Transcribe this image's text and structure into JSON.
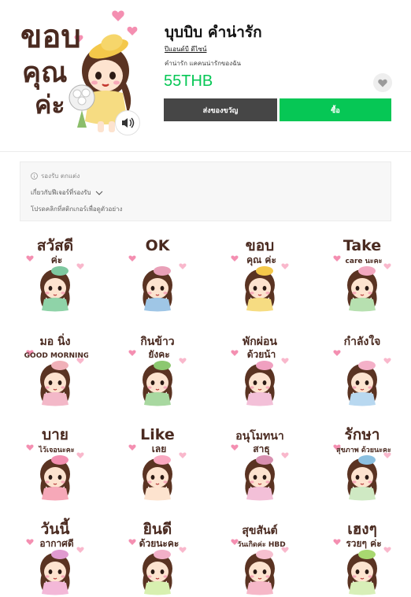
{
  "product": {
    "title": "บุบบิบ คำน่ารัก",
    "author": "ปีแอนด์บี ดีไซน์",
    "description": "คำน่ารัก แคคนน่ารักของฉัน",
    "price": "55THB",
    "gift_label": "ส่งของขวัญ",
    "buy_label": "ซื้อ",
    "main_caption_line1": "ขอบ",
    "main_caption_line2": "คุณ",
    "main_caption_line3": "ค่ะ",
    "sound_icon": "speaker-icon",
    "favorite_icon": "heart-icon"
  },
  "info": {
    "support_text": "รองรับ ตกแต่ง",
    "compat_text": "เกี่ยวกับฟีเจอร์ที่รองรับ",
    "preview_hint": "โปรดคลิกที่สติกเกอร์เพื่อดูตัวอย่าง"
  },
  "colors": {
    "accent_green": "#06c755",
    "dark_button": "#464646",
    "caption_brown": "#4a2a20",
    "hair_brown": "#5a3322"
  },
  "stickers": [
    {
      "l1": "สวัสดี",
      "l2": "ค่ะ"
    },
    {
      "l1": "OK",
      "l2": ""
    },
    {
      "l1": "ขอบ",
      "l2": "คุณ ค่ะ"
    },
    {
      "l1": "Take",
      "l2": "care นะคะ"
    },
    {
      "l1": "มอ นิ่ง",
      "l2": "GOOD MORNING"
    },
    {
      "l1": "กินข้าว",
      "l2": "ยังคะ"
    },
    {
      "l1": "พักผ่อน",
      "l2": "ด้วยน้า"
    },
    {
      "l1": "กำลังใจ",
      "l2": ""
    },
    {
      "l1": "บาย",
      "l2": "ไว้เจอนะคะ"
    },
    {
      "l1": "Like",
      "l2": "เลย"
    },
    {
      "l1": "อนุโมทนา",
      "l2": "สาธุ"
    },
    {
      "l1": "รักษา",
      "l2": "สุขภาพ ด้วยนะคะ"
    },
    {
      "l1": "วันนี้",
      "l2": "อากาศดี"
    },
    {
      "l1": "ยินดี",
      "l2": "ด้วยนะคะ"
    },
    {
      "l1": "สุขสันต์",
      "l2": "วันเกิดค่ะ HBD"
    },
    {
      "l1": "เฮงๆ",
      "l2": "รวยๆ ค่ะ"
    }
  ]
}
